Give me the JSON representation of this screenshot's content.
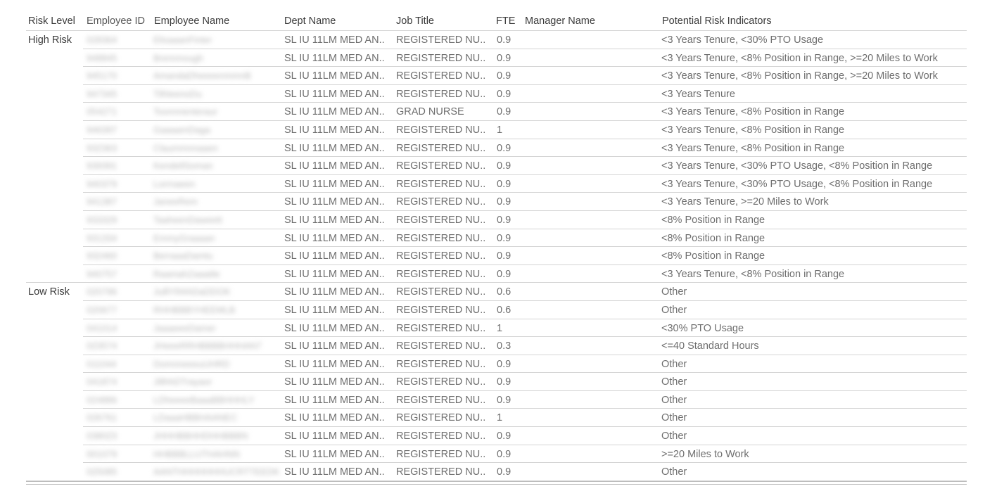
{
  "table": {
    "headers": {
      "risk_level": "Risk Level",
      "employee_id": "Employee ID",
      "employee_name": "Employee Name",
      "dept_name": "Dept Name",
      "job_title": "Job Title",
      "fte": "FTE",
      "manager_name": "Manager Name",
      "risk_indicators": "Potential Risk Indicators"
    },
    "groups": [
      {
        "label": "High Risk",
        "rows": [
          {
            "id": "028364",
            "name": "ElisaaanFinter",
            "dept": "SL IU 11LM MED AN..",
            "job": "REGISTERED NU..",
            "fte": "0.9",
            "manager": "",
            "indicators": "<3 Years Tenure, <30% PTO Usage"
          },
          {
            "id": "948845",
            "name": "Brennnough",
            "dept": "SL IU 11LM MED AN..",
            "job": "REGISTERED NU..",
            "fte": "0.9",
            "manager": "",
            "indicators": "<3 Years Tenure, <8% Position in Range, >=20 Miles to Work"
          },
          {
            "id": "945170",
            "name": "AmandaDheeeenmmnB",
            "dept": "SL IU 11LM MED AN..",
            "job": "REGISTERED NU..",
            "fte": "0.9",
            "manager": "",
            "indicators": "<3 Years Tenure, <8% Position in Range, >=20 Miles to Work"
          },
          {
            "id": "947345",
            "name": "TilhleenoDu",
            "dept": "SL IU 11LM MED AN..",
            "job": "REGISTERED NU..",
            "fte": "0.9",
            "manager": "",
            "indicators": "<3 Years Tenure"
          },
          {
            "id": "054271",
            "name": "Toonnnenteraur",
            "dept": "SL IU 11LM MED AN..",
            "job": "GRAD NURSE",
            "fte": "0.9",
            "manager": "",
            "indicators": "<3 Years Tenure, <8% Position in Range"
          },
          {
            "id": "946397",
            "name": "GaaaamDaga",
            "dept": "SL IU 11LM MED AN..",
            "job": "REGISTERED NU..",
            "fte": "1",
            "manager": "",
            "indicators": "<3 Years Tenure, <8% Position in Range"
          },
          {
            "id": "932363",
            "name": "Claummnnaaen",
            "dept": "SL IU 11LM MED AN..",
            "job": "REGISTERED NU..",
            "fte": "0.9",
            "manager": "",
            "indicators": "<3 Years Tenure, <8% Position in Range"
          },
          {
            "id": "939391",
            "name": "KendellSoman",
            "dept": "SL IU 11LM MED AN..",
            "job": "REGISTERED NU..",
            "fte": "0.9",
            "manager": "",
            "indicators": "<3 Years Tenure, <30% PTO Usage, <8% Position in Range"
          },
          {
            "id": "940379",
            "name": "Lorrnaeen",
            "dept": "SL IU 11LM MED AN..",
            "job": "REGISTERED NU..",
            "fte": "0.9",
            "manager": "",
            "indicators": "<3 Years Tenure, <30% PTO Usage, <8% Position in Range"
          },
          {
            "id": "941387",
            "name": "JaneeRem",
            "dept": "SL IU 11LM MED AN..",
            "job": "REGISTERED NU..",
            "fte": "0.9",
            "manager": "",
            "indicators": "<3 Years Tenure, >=20 Miles to Work"
          },
          {
            "id": "933329",
            "name": "TaaheenDaweett",
            "dept": "SL IU 11LM MED AN..",
            "job": "REGISTERED NU..",
            "fte": "0.9",
            "manager": "",
            "indicators": "<8% Position in Range"
          },
          {
            "id": "931334",
            "name": "EmmyGraaaan",
            "dept": "SL IU 11LM MED AN..",
            "job": "REGISTERED NU..",
            "fte": "0.9",
            "manager": "",
            "indicators": "<8% Position in Range"
          },
          {
            "id": "932460",
            "name": "BerraaaDamtu",
            "dept": "SL IU 11LM MED AN..",
            "job": "REGISTERED NU..",
            "fte": "0.9",
            "manager": "",
            "indicators": "<8% Position in Range"
          },
          {
            "id": "940757",
            "name": "RaamahZaaaiile",
            "dept": "SL IU 11LM MED AN..",
            "job": "REGISTERED NU..",
            "fte": "0.9",
            "manager": "",
            "indicators": "<3 Years Tenure, <8% Position in Range"
          }
        ]
      },
      {
        "label": "Low Risk",
        "rows": [
          {
            "id": "020796",
            "name": "JulllYlhhhDaDDOK",
            "dept": "SL IU 11LM MED AN..",
            "job": "REGISTERED NU..",
            "fte": "0.6",
            "manager": "",
            "indicators": "Other"
          },
          {
            "id": "020677",
            "name": "RHHBBBYHEEMLB",
            "dept": "SL IU 11LM MED AN..",
            "job": "REGISTERED NU..",
            "fte": "0.6",
            "manager": "",
            "indicators": "Other"
          },
          {
            "id": "041014",
            "name": "JaaaeeeDamer",
            "dept": "SL IU 11LM MED AN..",
            "job": "REGISTERED NU..",
            "fte": "1",
            "manager": "",
            "indicators": "<30% PTO Usage"
          },
          {
            "id": "023574",
            "name": "JHeeeRRHBBBBHHHAN7",
            "dept": "SL IU 11LM MED AN..",
            "job": "REGISTERED NU..",
            "fte": "0.3",
            "manager": "",
            "indicators": "<=40 Standard Hours"
          },
          {
            "id": "011044",
            "name": "DomnneeeuUHRD",
            "dept": "SL IU 11LM MED AN..",
            "job": "REGISTERED NU..",
            "fte": "0.9",
            "manager": "",
            "indicators": "Other"
          },
          {
            "id": "041874",
            "name": "JillhhDTrayaor",
            "dept": "SL IU 11LM MED AN..",
            "job": "REGISTERED NU..",
            "fte": "0.9",
            "manager": "",
            "indicators": "Other"
          },
          {
            "id": "024886",
            "name": "LDheeeeBaaaBBHHHLY",
            "dept": "SL IU 11LM MED AN..",
            "job": "REGISTERED NU..",
            "fte": "0.9",
            "manager": "",
            "indicators": "Other"
          },
          {
            "id": "026761",
            "name": "LDaaaHBBHAANEC",
            "dept": "SL IU 11LM MED AN..",
            "job": "REGISTERED NU..",
            "fte": "1",
            "manager": "",
            "indicators": "Other"
          },
          {
            "id": "038023",
            "name": "JHHHBBHHDHHBBBN",
            "dept": "SL IU 11LM MED AN..",
            "job": "REGISTERED NU..",
            "fte": "0.9",
            "manager": "",
            "indicators": "Other"
          },
          {
            "id": "001079",
            "name": "HHBBBLLUTHAHNN",
            "dept": "SL IU 11LM MED AN..",
            "job": "REGISTERED NU..",
            "fte": "0.9",
            "manager": "",
            "indicators": ">=20 Miles to Work"
          },
          {
            "id": "025085",
            "name": "AANTHHHHHHHUCRTTEEDKA",
            "dept": "SL IU 11LM MED AN..",
            "job": "REGISTERED NU..",
            "fte": "0.9",
            "manager": "",
            "indicators": "Other"
          }
        ]
      }
    ]
  }
}
